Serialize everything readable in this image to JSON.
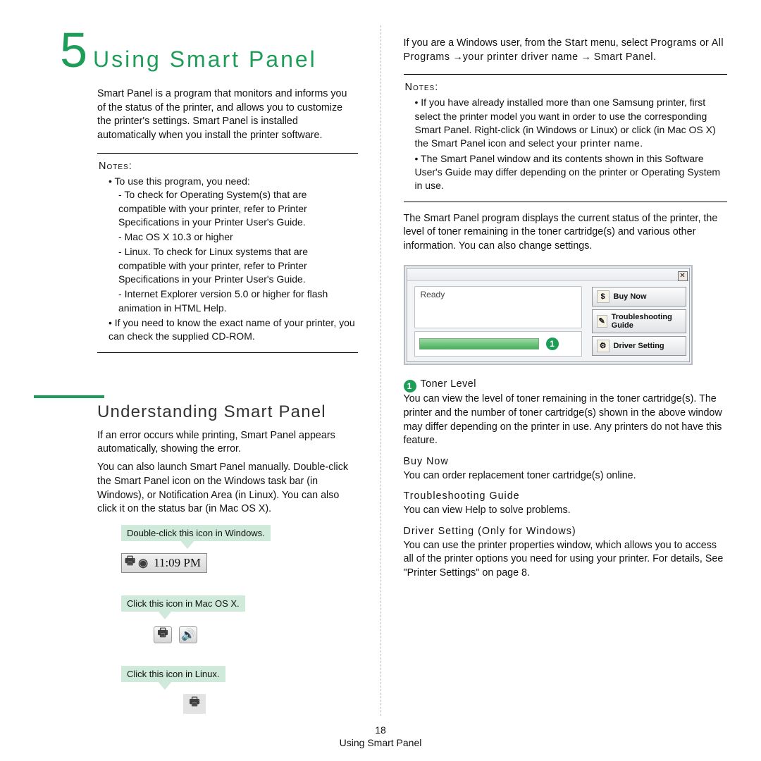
{
  "chapter": {
    "number": "5",
    "title": "Using Smart Panel"
  },
  "intro": "Smart Panel is a program that monitors and informs you of the status of the printer, and allows you to customize the printer's settings. Smart Panel is installed automatically when you install the printer software.",
  "notes_left": {
    "label": "Notes:",
    "b1": "To use this program, you need:",
    "d1": "To check for Operating System(s) that are compatible with your printer, refer to Printer Specifications in your Printer User's Guide.",
    "d2": "Mac OS X 10.3 or higher",
    "d3": "Linux. To check for Linux systems that are compatible with your printer, refer to Printer Specifications in your Printer User's Guide.",
    "d4": "Internet Explorer version 5.0 or higher for flash animation in HTML Help.",
    "b2": "If you need to know the exact name of your printer, you can check the supplied CD-ROM."
  },
  "subhead": "Understanding Smart Panel",
  "sub_p1": "If an error occurs while printing, Smart Panel appears automatically, showing the error.",
  "sub_p2": "You can also launch Smart Panel manually. Double-click the Smart Panel icon on the Windows task bar (in Windows), or Notification Area (in Linux). You can also click it on the status bar (in Mac OS X).",
  "callouts": {
    "win": "Double-click this icon in Windows.",
    "time": "11:09 PM",
    "mac": "Click this icon in Mac OS X.",
    "linux": "Click this icon in Linux."
  },
  "right_intro_a": "If you are a Windows user, from the ",
  "right_intro_b": "Start",
  "right_intro_c": " menu, select ",
  "right_intro_d": "Programs",
  "right_intro_e": " or ",
  "right_intro_f": "All Programs",
  "right_intro_g": "  →",
  "right_intro_h": "your printer driver name",
  "right_intro_i": " → ",
  "right_intro_j": "Smart Panel",
  "right_intro_k": ".",
  "notes_right": {
    "label": "Notes:",
    "b1a": "If you have already installed more than one Samsung printer, first select the printer model you want in order to use the corresponding Smart Panel. Right-click (in Windows or Linux) or click (in Mac OS X) the Smart Panel icon and select ",
    "b1b": "your printer name",
    "b1c": ".",
    "b2": "The Smart Panel window and its contents shown in this Software User's Guide may differ depending on the printer or Operating System in use."
  },
  "right_p2": "The Smart Panel program displays the current status of the printer, the level of toner remaining in the toner cartridge(s) and various other information. You can also change settings.",
  "panel": {
    "status": "Ready",
    "btn1": "Buy Now",
    "btn2": "Troubleshooting Guide",
    "btn3": "Driver Setting",
    "marker": "1"
  },
  "defs": {
    "n1": "1",
    "t1": "Toner Level",
    "p1": "You can view the level of toner remaining in the toner cartridge(s). The printer and the number of toner cartridge(s) shown in the above window may differ depending on the printer in use. Any printers do not have this feature.",
    "t2": "Buy Now",
    "p2": "You can order replacement toner cartridge(s) online.",
    "t3": "Troubleshooting Guide",
    "p3": "You can view Help to solve problems.",
    "t4": "Driver Setting (Only for Windows)",
    "p4": "You can use the printer properties window, which allows you to access all of the printer options you need for using your printer. For details, See \"Printer Settings\" on page 8."
  },
  "footer": {
    "page": "18",
    "title": "Using Smart Panel"
  }
}
